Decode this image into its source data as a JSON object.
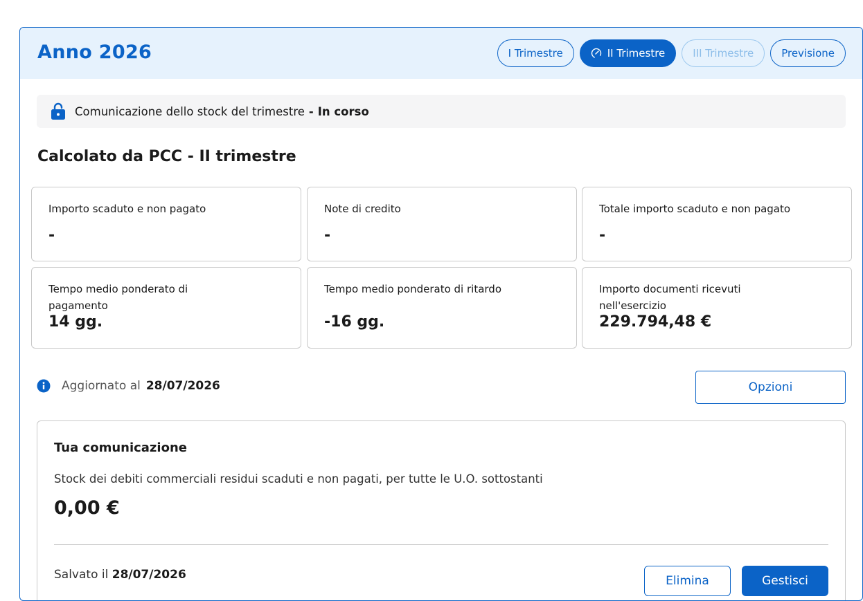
{
  "header": {
    "title": "Anno 2026",
    "tabs": [
      {
        "label": "I Trimestre",
        "state": "default"
      },
      {
        "label": "II Trimestre",
        "state": "active",
        "icon": "gauge-icon"
      },
      {
        "label": "III Trimestre",
        "state": "disabled"
      },
      {
        "label": "Previsione",
        "state": "default"
      }
    ]
  },
  "status": {
    "icon": "lock-open-icon",
    "text": "Comunicazione dello stock del trimestre",
    "separator": "-",
    "state": "In corso"
  },
  "section_title": "Calcolato da PCC - II trimestre",
  "metrics": [
    {
      "label": "Importo scaduto e non pagato",
      "value": "-"
    },
    {
      "label": "Note di credito",
      "value": "-"
    },
    {
      "label": "Totale importo scaduto e non pagato",
      "value": "-"
    },
    {
      "label": "Tempo medio ponderato di pagamento",
      "value": "14 gg."
    },
    {
      "label": "Tempo medio ponderato di ritardo",
      "value": "-16 gg."
    },
    {
      "label": "Importo documenti ricevuti nell'esercizio",
      "value": "229.794,48 €"
    }
  ],
  "updated": {
    "label": "Aggiornato al",
    "date": "28/07/2026",
    "icon": "info-icon"
  },
  "options_button": "Opzioni",
  "communication": {
    "title": "Tua comunicazione",
    "description": "Stock dei debiti commerciali residui scaduti e non pagati, per tutte le U.O. sottostanti",
    "amount": "0,00 €",
    "saved_label": "Salvato il",
    "saved_date": "28/07/2026",
    "delete_button": "Elimina",
    "manage_button": "Gestisci"
  },
  "colors": {
    "primary": "#0b63c7",
    "header_bg": "#e6f2fd",
    "status_bg": "#f5f5f6"
  }
}
